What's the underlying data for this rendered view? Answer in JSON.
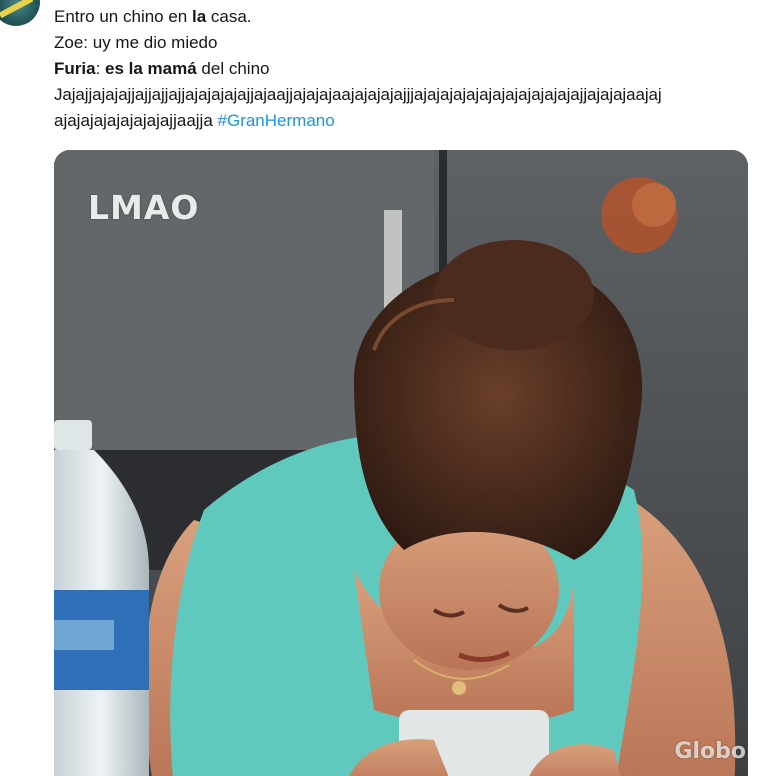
{
  "tweet": {
    "line1": {
      "prefix": "Entro un chino en ",
      "bold": "la",
      "suffix": " casa."
    },
    "line2": "Zoe: uy me dio miedo",
    "line3": {
      "speaker": "Furia",
      "colon": ": ",
      "bold": "es la mamá",
      "suffix": " del chino"
    },
    "line4": "Jajajjajajajjajjajjajjajajajajajjajaajjajajajaajajajajajjjajajajajajajajajajajajajajjajajajaajaj",
    "line5_text": "ajajajajajajajajajjaajja ",
    "hashtag": "#GranHermano"
  },
  "media": {
    "overlay_text": "LMAO",
    "watermark": "Globo"
  },
  "colors": {
    "hashtag": "#1b95e0",
    "text": "#14171a",
    "shirt": "#5fc9bd",
    "bottle_label": "#2f6fb8"
  }
}
